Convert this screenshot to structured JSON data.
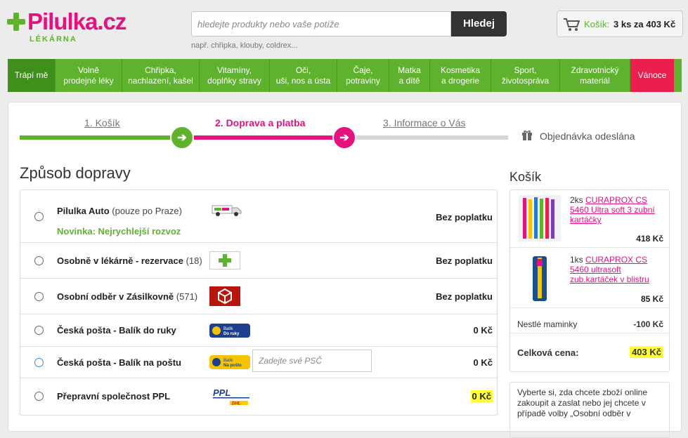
{
  "header": {
    "logo_text": "Pilulka.cz",
    "logo_sub": "LÉKÁRNA",
    "search_placeholder": "hledejte produkty nebo vaše potíže",
    "search_button": "Hledej",
    "search_hint": "např. chřipka, klouby, coldrex...",
    "cart_label": "Košík:",
    "cart_summary": "3 ks za 403 Kč"
  },
  "nav": [
    {
      "line1": "Trápí mě",
      "line2": ""
    },
    {
      "line1": "Volně",
      "line2": "prodejné léky"
    },
    {
      "line1": "Chřipka,",
      "line2": "nachlazení, kašel"
    },
    {
      "line1": "Vitamíny,",
      "line2": "doplňky stravy"
    },
    {
      "line1": "Oči,",
      "line2": "uši, nos a ústa"
    },
    {
      "line1": "Čaje,",
      "line2": "potraviny"
    },
    {
      "line1": "Matka",
      "line2": "a dítě"
    },
    {
      "line1": "Kosmetika",
      "line2": "a drogerie"
    },
    {
      "line1": "Sport,",
      "line2": "životospráva"
    },
    {
      "line1": "Zdravotnický",
      "line2": "materiál"
    },
    {
      "line1": "Vánoce",
      "line2": ""
    }
  ],
  "steps": {
    "s1": "1. Košík",
    "s2": "2. Doprava a platba",
    "s3": "3. Informace o Vás",
    "s4": "Objednávka odeslána"
  },
  "shipping": {
    "title": "Způsob dopravy",
    "options": [
      {
        "name": "Pilulka Auto",
        "note": "(pouze po Praze)",
        "sub": "Novinka: Nejrychlejší rozvoz",
        "price": "Bez poplatku"
      },
      {
        "name": "Osobně v lékárně - rezervace",
        "note": "(18)",
        "price": "Bez poplatku"
      },
      {
        "name": "Osobní odběr v Zásilkovně",
        "note": "(571)",
        "price": "Bez poplatku"
      },
      {
        "name": "Česká pošta - Balík do ruky",
        "note": "",
        "price": "0 Kč"
      },
      {
        "name": "Česká pošta - Balík na poštu",
        "note": "",
        "price": "0 Kč",
        "input_placeholder": "Zadejte své PSČ"
      },
      {
        "name": "Přepravní společnost PPL",
        "note": "",
        "price": "0 Kč"
      }
    ]
  },
  "cart": {
    "title": "Košík",
    "items": [
      {
        "qty": "2ks",
        "name": "CURAPROX CS 5460 Ultra soft 3 zubní kartáčky",
        "price": "418 Kč"
      },
      {
        "qty": "1ks",
        "name": "CURAPROX CS 5460 ultrasoft zub.kartáček v blistru",
        "price": "85 Kč"
      }
    ],
    "discount_label": "Nestlé maminky",
    "discount_value": "-100 Kč",
    "total_label": "Celková cena:",
    "total_value": "403 Kč",
    "info_text": "Vyberte si, zda chcete zboží online zakoupit a zaslat nebo jej chcete v případě volby „Osobní odběr v"
  }
}
